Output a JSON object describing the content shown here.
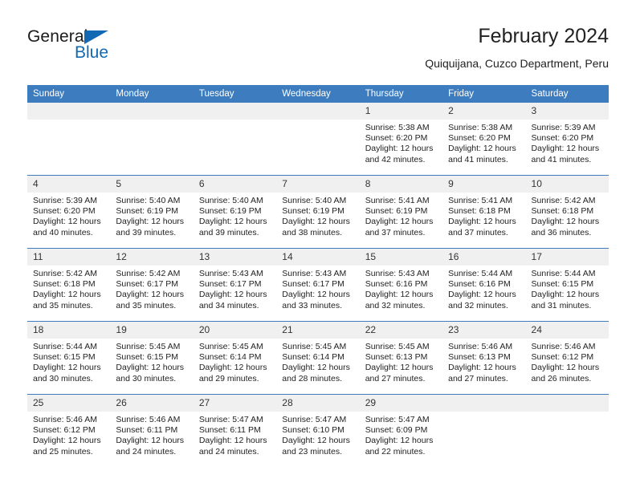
{
  "brand": {
    "name_part1": "General",
    "name_part2": "Blue",
    "logo_icon": "triangle-logo-icon",
    "color_primary": "#1268b3"
  },
  "header": {
    "title": "February 2024",
    "subtitle": "Quiquijana, Cuzco Department, Peru"
  },
  "theme": {
    "header_blue": "#3c7cbf",
    "daynum_band": "#f0f0f0"
  },
  "calendar": {
    "weekday_headers": [
      "Sunday",
      "Monday",
      "Tuesday",
      "Wednesday",
      "Thursday",
      "Friday",
      "Saturday"
    ],
    "weeks": [
      [
        {
          "day": "",
          "blank": true,
          "lines": []
        },
        {
          "day": "",
          "blank": true,
          "lines": []
        },
        {
          "day": "",
          "blank": true,
          "lines": []
        },
        {
          "day": "",
          "blank": true,
          "lines": []
        },
        {
          "day": "1",
          "blank": false,
          "lines": [
            "Sunrise: 5:38 AM",
            "Sunset: 6:20 PM",
            "Daylight: 12 hours",
            "and 42 minutes."
          ]
        },
        {
          "day": "2",
          "blank": false,
          "lines": [
            "Sunrise: 5:38 AM",
            "Sunset: 6:20 PM",
            "Daylight: 12 hours",
            "and 41 minutes."
          ]
        },
        {
          "day": "3",
          "blank": false,
          "lines": [
            "Sunrise: 5:39 AM",
            "Sunset: 6:20 PM",
            "Daylight: 12 hours",
            "and 41 minutes."
          ]
        }
      ],
      [
        {
          "day": "4",
          "blank": false,
          "lines": [
            "Sunrise: 5:39 AM",
            "Sunset: 6:20 PM",
            "Daylight: 12 hours",
            "and 40 minutes."
          ]
        },
        {
          "day": "5",
          "blank": false,
          "lines": [
            "Sunrise: 5:40 AM",
            "Sunset: 6:19 PM",
            "Daylight: 12 hours",
            "and 39 minutes."
          ]
        },
        {
          "day": "6",
          "blank": false,
          "lines": [
            "Sunrise: 5:40 AM",
            "Sunset: 6:19 PM",
            "Daylight: 12 hours",
            "and 39 minutes."
          ]
        },
        {
          "day": "7",
          "blank": false,
          "lines": [
            "Sunrise: 5:40 AM",
            "Sunset: 6:19 PM",
            "Daylight: 12 hours",
            "and 38 minutes."
          ]
        },
        {
          "day": "8",
          "blank": false,
          "lines": [
            "Sunrise: 5:41 AM",
            "Sunset: 6:19 PM",
            "Daylight: 12 hours",
            "and 37 minutes."
          ]
        },
        {
          "day": "9",
          "blank": false,
          "lines": [
            "Sunrise: 5:41 AM",
            "Sunset: 6:18 PM",
            "Daylight: 12 hours",
            "and 37 minutes."
          ]
        },
        {
          "day": "10",
          "blank": false,
          "lines": [
            "Sunrise: 5:42 AM",
            "Sunset: 6:18 PM",
            "Daylight: 12 hours",
            "and 36 minutes."
          ]
        }
      ],
      [
        {
          "day": "11",
          "blank": false,
          "lines": [
            "Sunrise: 5:42 AM",
            "Sunset: 6:18 PM",
            "Daylight: 12 hours",
            "and 35 minutes."
          ]
        },
        {
          "day": "12",
          "blank": false,
          "lines": [
            "Sunrise: 5:42 AM",
            "Sunset: 6:17 PM",
            "Daylight: 12 hours",
            "and 35 minutes."
          ]
        },
        {
          "day": "13",
          "blank": false,
          "lines": [
            "Sunrise: 5:43 AM",
            "Sunset: 6:17 PM",
            "Daylight: 12 hours",
            "and 34 minutes."
          ]
        },
        {
          "day": "14",
          "blank": false,
          "lines": [
            "Sunrise: 5:43 AM",
            "Sunset: 6:17 PM",
            "Daylight: 12 hours",
            "and 33 minutes."
          ]
        },
        {
          "day": "15",
          "blank": false,
          "lines": [
            "Sunrise: 5:43 AM",
            "Sunset: 6:16 PM",
            "Daylight: 12 hours",
            "and 32 minutes."
          ]
        },
        {
          "day": "16",
          "blank": false,
          "lines": [
            "Sunrise: 5:44 AM",
            "Sunset: 6:16 PM",
            "Daylight: 12 hours",
            "and 32 minutes."
          ]
        },
        {
          "day": "17",
          "blank": false,
          "lines": [
            "Sunrise: 5:44 AM",
            "Sunset: 6:15 PM",
            "Daylight: 12 hours",
            "and 31 minutes."
          ]
        }
      ],
      [
        {
          "day": "18",
          "blank": false,
          "lines": [
            "Sunrise: 5:44 AM",
            "Sunset: 6:15 PM",
            "Daylight: 12 hours",
            "and 30 minutes."
          ]
        },
        {
          "day": "19",
          "blank": false,
          "lines": [
            "Sunrise: 5:45 AM",
            "Sunset: 6:15 PM",
            "Daylight: 12 hours",
            "and 30 minutes."
          ]
        },
        {
          "day": "20",
          "blank": false,
          "lines": [
            "Sunrise: 5:45 AM",
            "Sunset: 6:14 PM",
            "Daylight: 12 hours",
            "and 29 minutes."
          ]
        },
        {
          "day": "21",
          "blank": false,
          "lines": [
            "Sunrise: 5:45 AM",
            "Sunset: 6:14 PM",
            "Daylight: 12 hours",
            "and 28 minutes."
          ]
        },
        {
          "day": "22",
          "blank": false,
          "lines": [
            "Sunrise: 5:45 AM",
            "Sunset: 6:13 PM",
            "Daylight: 12 hours",
            "and 27 minutes."
          ]
        },
        {
          "day": "23",
          "blank": false,
          "lines": [
            "Sunrise: 5:46 AM",
            "Sunset: 6:13 PM",
            "Daylight: 12 hours",
            "and 27 minutes."
          ]
        },
        {
          "day": "24",
          "blank": false,
          "lines": [
            "Sunrise: 5:46 AM",
            "Sunset: 6:12 PM",
            "Daylight: 12 hours",
            "and 26 minutes."
          ]
        }
      ],
      [
        {
          "day": "25",
          "blank": false,
          "lines": [
            "Sunrise: 5:46 AM",
            "Sunset: 6:12 PM",
            "Daylight: 12 hours",
            "and 25 minutes."
          ]
        },
        {
          "day": "26",
          "blank": false,
          "lines": [
            "Sunrise: 5:46 AM",
            "Sunset: 6:11 PM",
            "Daylight: 12 hours",
            "and 24 minutes."
          ]
        },
        {
          "day": "27",
          "blank": false,
          "lines": [
            "Sunrise: 5:47 AM",
            "Sunset: 6:11 PM",
            "Daylight: 12 hours",
            "and 24 minutes."
          ]
        },
        {
          "day": "28",
          "blank": false,
          "lines": [
            "Sunrise: 5:47 AM",
            "Sunset: 6:10 PM",
            "Daylight: 12 hours",
            "and 23 minutes."
          ]
        },
        {
          "day": "29",
          "blank": false,
          "lines": [
            "Sunrise: 5:47 AM",
            "Sunset: 6:09 PM",
            "Daylight: 12 hours",
            "and 22 minutes."
          ]
        },
        {
          "day": "",
          "blank": true,
          "lines": []
        },
        {
          "day": "",
          "blank": true,
          "lines": []
        }
      ]
    ]
  }
}
